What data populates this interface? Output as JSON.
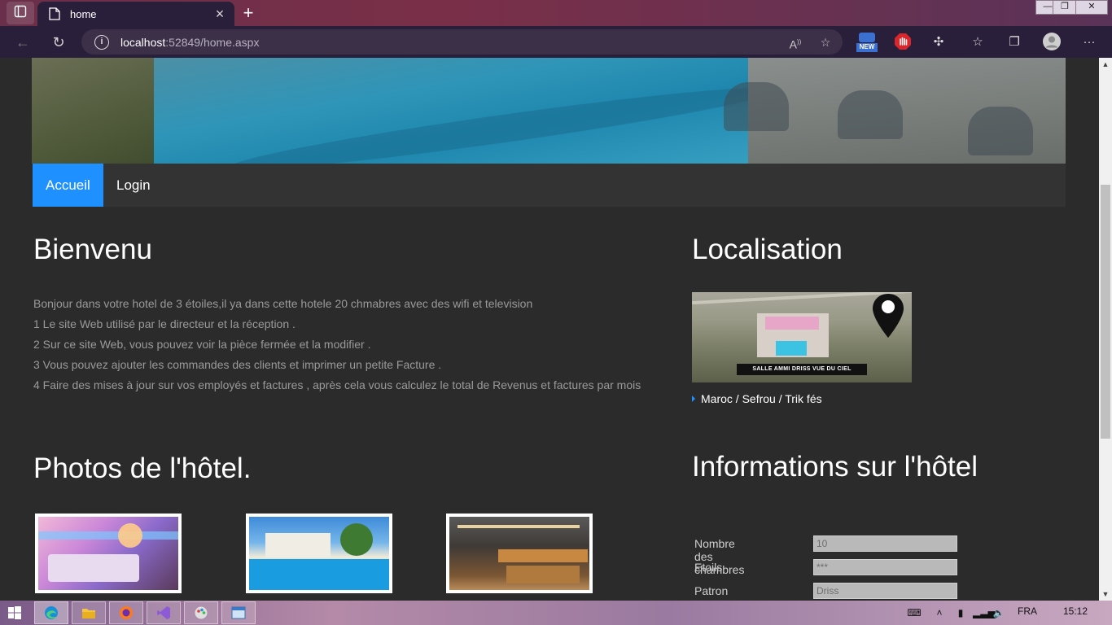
{
  "browser": {
    "tab_title": "home",
    "url_host": "localhost",
    "url_path": ":52849/home.aspx",
    "new_badge": "NEW",
    "icons": [
      "tabs-icon",
      "page-icon",
      "close-icon",
      "new-tab-icon",
      "back-icon",
      "refresh-icon",
      "info-icon",
      "read-aloud-icon",
      "favorite-add-icon",
      "extension-new-icon",
      "adblock-icon",
      "extensions-icon",
      "favorites-icon",
      "collections-icon",
      "profile-icon",
      "more-icon"
    ]
  },
  "nav": {
    "items": [
      {
        "label": "Accueil",
        "active": true
      },
      {
        "label": "Login",
        "active": false
      }
    ],
    "accent_color": "#1e90ff"
  },
  "welcome": {
    "title": "Bienvenu",
    "lines": [
      "Bonjour dans votre hotel de 3 étoiles,il ya dans cette hotele 20 chmabres avec des wifi et television",
      "1 Le site Web utilisé par le directeur et la réception .",
      "2 Sur ce site Web, vous pouvez voir la pièce fermée et la modifier .",
      "3 Vous pouvez ajouter les commandes des clients et imprimer un petite Facture .",
      "4 Faire des mises à jour sur vos employés et factures , après cela vous calculez le total de Revenus et factures par mois"
    ]
  },
  "location": {
    "title": "Localisation",
    "map_caption": "SALLE AMMI DRISS VUE DU CIEL",
    "address": "Maroc / Sefrou / Trik fés"
  },
  "photos": {
    "title": "Photos de l'hôtel."
  },
  "info": {
    "title": "Informations sur l'hôtel",
    "rows": [
      {
        "label": "Nombre des chambres",
        "value": "10"
      },
      {
        "label": "Etoils",
        "value": "***"
      },
      {
        "label": "Patron",
        "value": "Driss"
      }
    ]
  },
  "taskbar": {
    "language": "FRA",
    "time": "15:12"
  }
}
